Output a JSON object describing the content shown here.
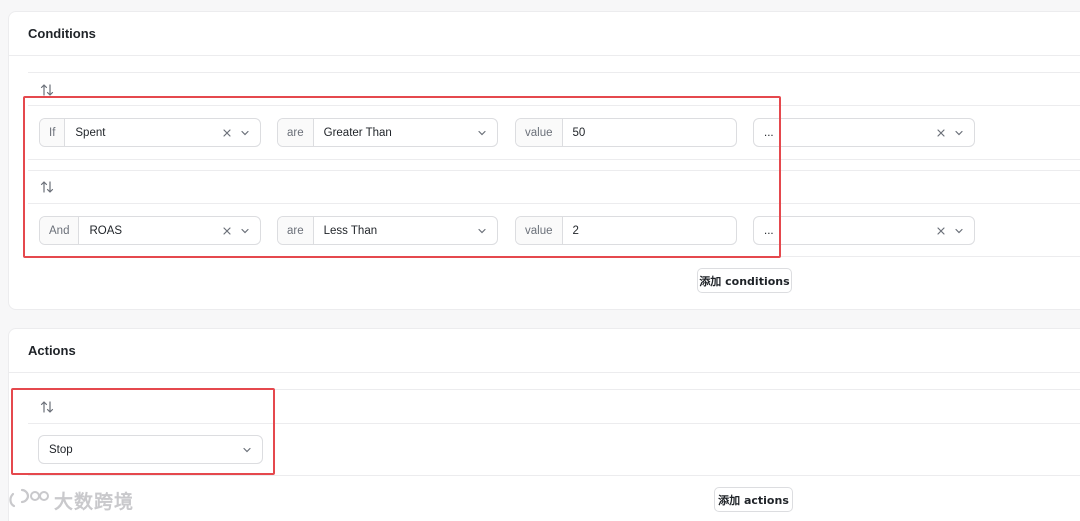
{
  "conditions": {
    "title": "Conditions",
    "rows": [
      {
        "connector": "If",
        "metric": "Spent",
        "operator_prefix": "are",
        "operator": "Greater Than",
        "value_prefix": "value",
        "value": "50",
        "extra": "..."
      },
      {
        "connector": "And",
        "metric": "ROAS",
        "operator_prefix": "are",
        "operator": "Less Than",
        "value_prefix": "value",
        "value": "2",
        "extra": "..."
      }
    ],
    "add_button": "添加 conditions"
  },
  "actions": {
    "title": "Actions",
    "selected_action": "Stop",
    "add_button": "添加 actions"
  },
  "watermark": "大数跨境",
  "colors": {
    "highlight": "#e5484d",
    "border": "#dcdde0",
    "background": "#f7f7f8"
  }
}
